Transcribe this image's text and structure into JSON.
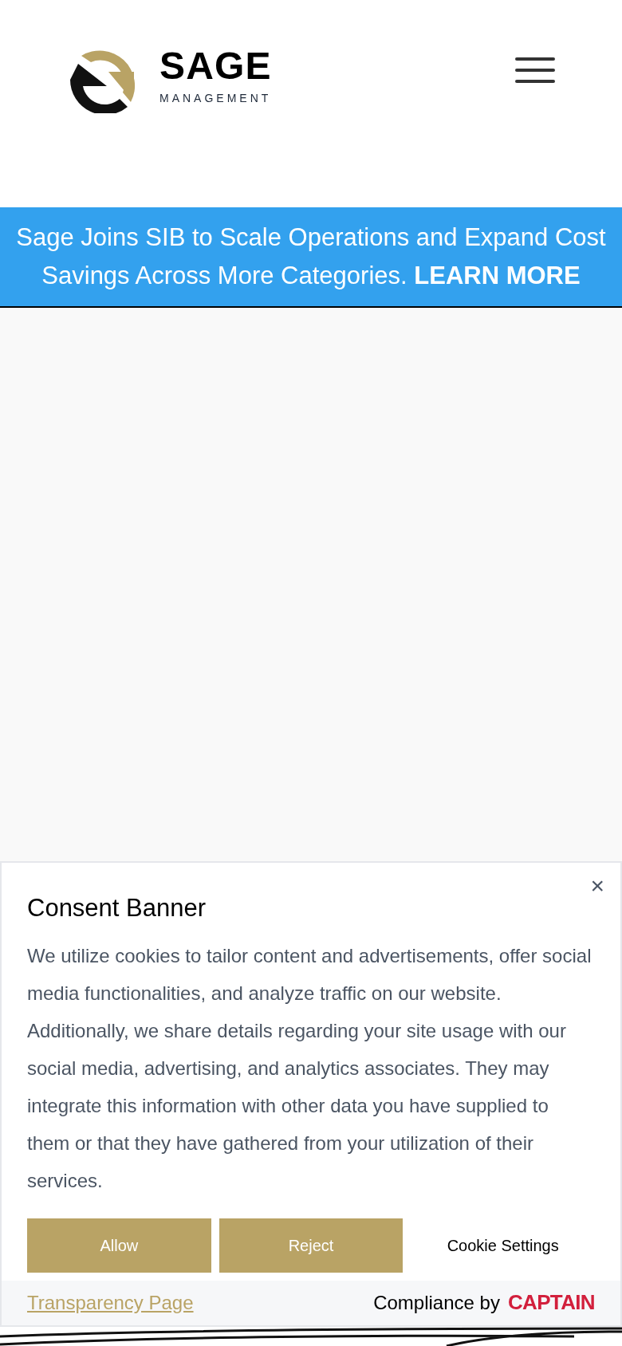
{
  "header": {
    "logo": {
      "name": "SAGE",
      "tagline": "MANAGEMENT"
    }
  },
  "announcement": {
    "text": "Sage Joins SIB to Scale Operations and Expand Cost Savings Across More Categories.",
    "link": "LEARN MORE"
  },
  "consent": {
    "title": "Consent Banner",
    "close": "×",
    "body": "We utilize cookies to tailor content and advertisements, offer social media functionalities, and analyze traffic on our website. Additionally, we share details regarding your site usage with our social media, advertising, and analytics associates. They may integrate this information with other data you have supplied to them or that they have gathered from your utilization of their services.",
    "buttons": [
      {
        "label": "Allow",
        "kind": "filled"
      },
      {
        "label": "Reject",
        "kind": "filled"
      },
      {
        "label": "Cookie Settings",
        "kind": "plain"
      }
    ],
    "footer": {
      "link": "Transparency Page",
      "credit": "Compliance by",
      "brand": "CAPTAIN"
    }
  }
}
